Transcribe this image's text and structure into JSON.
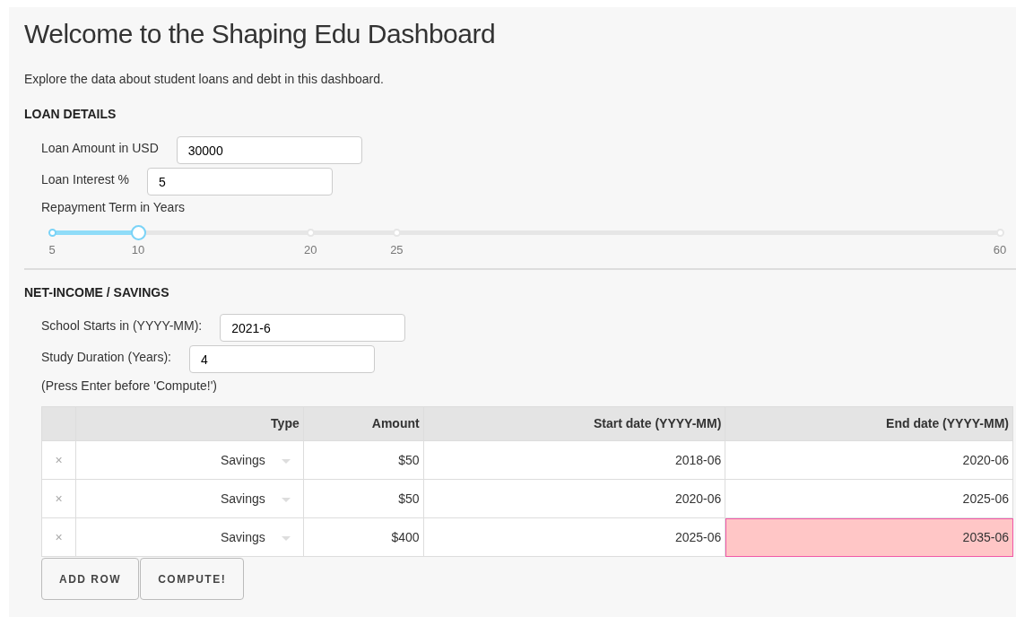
{
  "title": "Welcome to the Shaping Edu Dashboard",
  "intro": "Explore the data about student loans and debt in this dashboard.",
  "loan_details": {
    "heading": "LOAN DETAILS",
    "fields": [
      {
        "label": "Loan Amount in USD",
        "value": "30000"
      },
      {
        "label": "Loan Interest %",
        "value": "5"
      }
    ],
    "slider": {
      "label": "Repayment Term in Years",
      "level": 0.0909,
      "ticks": [
        "5",
        "10",
        "20",
        "25",
        "60"
      ]
    }
  },
  "net_income": {
    "heading": "NET-INCOME / SAVINGS",
    "fields": [
      {
        "label": "School Starts in (YYYY-MM):",
        "value": "2021-6"
      },
      {
        "label": "Study Duration (Years):",
        "value": "4"
      }
    ],
    "note": "(Press Enter before 'Compute!')",
    "table": {
      "columns": [
        "Type",
        "Amount",
        "Start date (YYYY-MM)",
        "End date (YYYY-MM)"
      ],
      "rows": [
        {
          "delete": "×",
          "type": "Savings",
          "amount": "$50",
          "start": "2018-06",
          "end": "2020-06",
          "end_invalid": false
        },
        {
          "delete": "×",
          "type": "Savings",
          "amount": "$50",
          "start": "2020-06",
          "end": "2025-06",
          "end_invalid": false
        },
        {
          "delete": "×",
          "type": "Savings",
          "amount": "$400",
          "start": "2025-06",
          "end": "2035-06",
          "end_invalid": true
        }
      ]
    },
    "buttons": [
      "ADD ROW",
      "COMPUTE!"
    ]
  }
}
